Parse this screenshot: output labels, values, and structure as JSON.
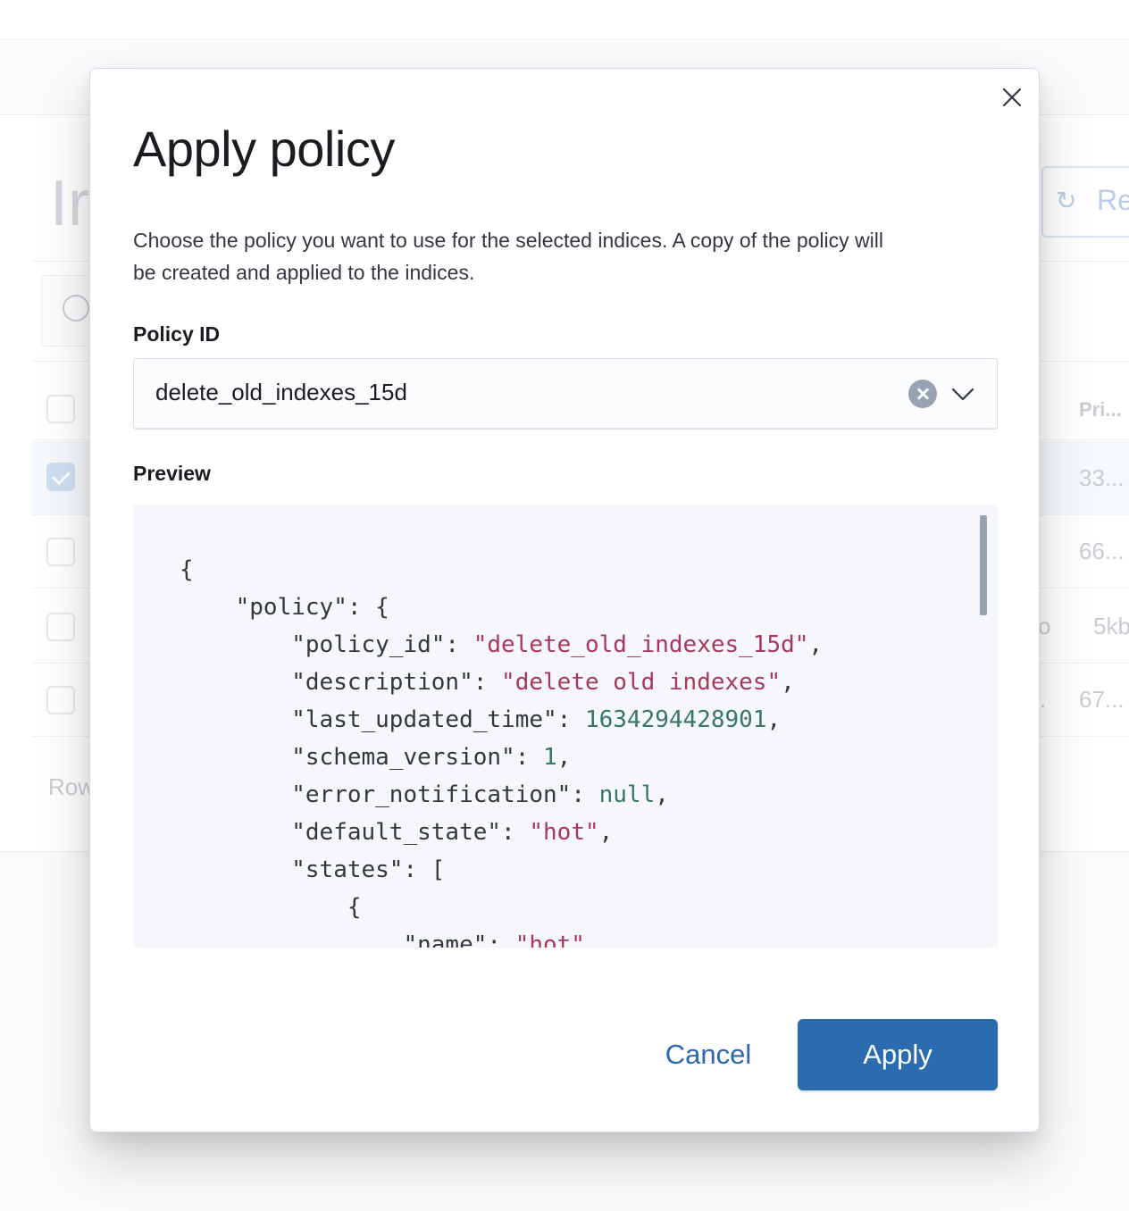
{
  "background": {
    "page_title_fragment": "Ir",
    "refresh_label_fragment": "Re",
    "column_header_fragment": "Pri...",
    "row_values": [
      "33...",
      "66...",
      "5kb",
      "67..."
    ],
    "row_prefix_fragments": [
      "o",
      "."
    ],
    "rows_per_page_fragment": "Row"
  },
  "modal": {
    "title": "Apply policy",
    "description": "Choose the policy you want to use for the selected indices. A copy of the policy will be created and applied to the indices.",
    "policy_id_label": "Policy ID",
    "policy_id_value": "delete_old_indexes_15d",
    "preview_label": "Preview",
    "cancel_label": "Cancel",
    "apply_label": "Apply",
    "colors": {
      "primary": "#2b6bb0",
      "link": "#2a68b1",
      "string": "#a8385d",
      "number": "#387765"
    }
  },
  "preview": {
    "lines": [
      {
        "indent": 0,
        "parts": [
          {
            "t": "{",
            "c": "p"
          }
        ]
      },
      {
        "indent": 1,
        "parts": [
          {
            "t": "\"policy\"",
            "c": "k"
          },
          {
            "t": ": {",
            "c": "p"
          }
        ]
      },
      {
        "indent": 2,
        "parts": [
          {
            "t": "\"policy_id\"",
            "c": "k"
          },
          {
            "t": ": ",
            "c": "p"
          },
          {
            "t": "\"delete_old_indexes_15d\"",
            "c": "s"
          },
          {
            "t": ",",
            "c": "p"
          }
        ]
      },
      {
        "indent": 2,
        "parts": [
          {
            "t": "\"description\"",
            "c": "k"
          },
          {
            "t": ": ",
            "c": "p"
          },
          {
            "t": "\"delete old indexes\"",
            "c": "s"
          },
          {
            "t": ",",
            "c": "p"
          }
        ]
      },
      {
        "indent": 2,
        "parts": [
          {
            "t": "\"last_updated_time\"",
            "c": "k"
          },
          {
            "t": ": ",
            "c": "p"
          },
          {
            "t": "1634294428901",
            "c": "n"
          },
          {
            "t": ",",
            "c": "p"
          }
        ]
      },
      {
        "indent": 2,
        "parts": [
          {
            "t": "\"schema_version\"",
            "c": "k"
          },
          {
            "t": ": ",
            "c": "p"
          },
          {
            "t": "1",
            "c": "n"
          },
          {
            "t": ",",
            "c": "p"
          }
        ]
      },
      {
        "indent": 2,
        "parts": [
          {
            "t": "\"error_notification\"",
            "c": "k"
          },
          {
            "t": ": ",
            "c": "p"
          },
          {
            "t": "null",
            "c": "n"
          },
          {
            "t": ",",
            "c": "p"
          }
        ]
      },
      {
        "indent": 2,
        "parts": [
          {
            "t": "\"default_state\"",
            "c": "k"
          },
          {
            "t": ": ",
            "c": "p"
          },
          {
            "t": "\"hot\"",
            "c": "s"
          },
          {
            "t": ",",
            "c": "p"
          }
        ]
      },
      {
        "indent": 2,
        "parts": [
          {
            "t": "\"states\"",
            "c": "k"
          },
          {
            "t": ": [",
            "c": "p"
          }
        ]
      },
      {
        "indent": 3,
        "parts": [
          {
            "t": "{",
            "c": "p"
          }
        ]
      },
      {
        "indent": 4,
        "parts": [
          {
            "t": "\"name\"",
            "c": "k"
          },
          {
            "t": ": ",
            "c": "p"
          },
          {
            "t": "\"hot\"",
            "c": "s"
          },
          {
            "t": ",",
            "c": "p"
          }
        ]
      }
    ]
  }
}
